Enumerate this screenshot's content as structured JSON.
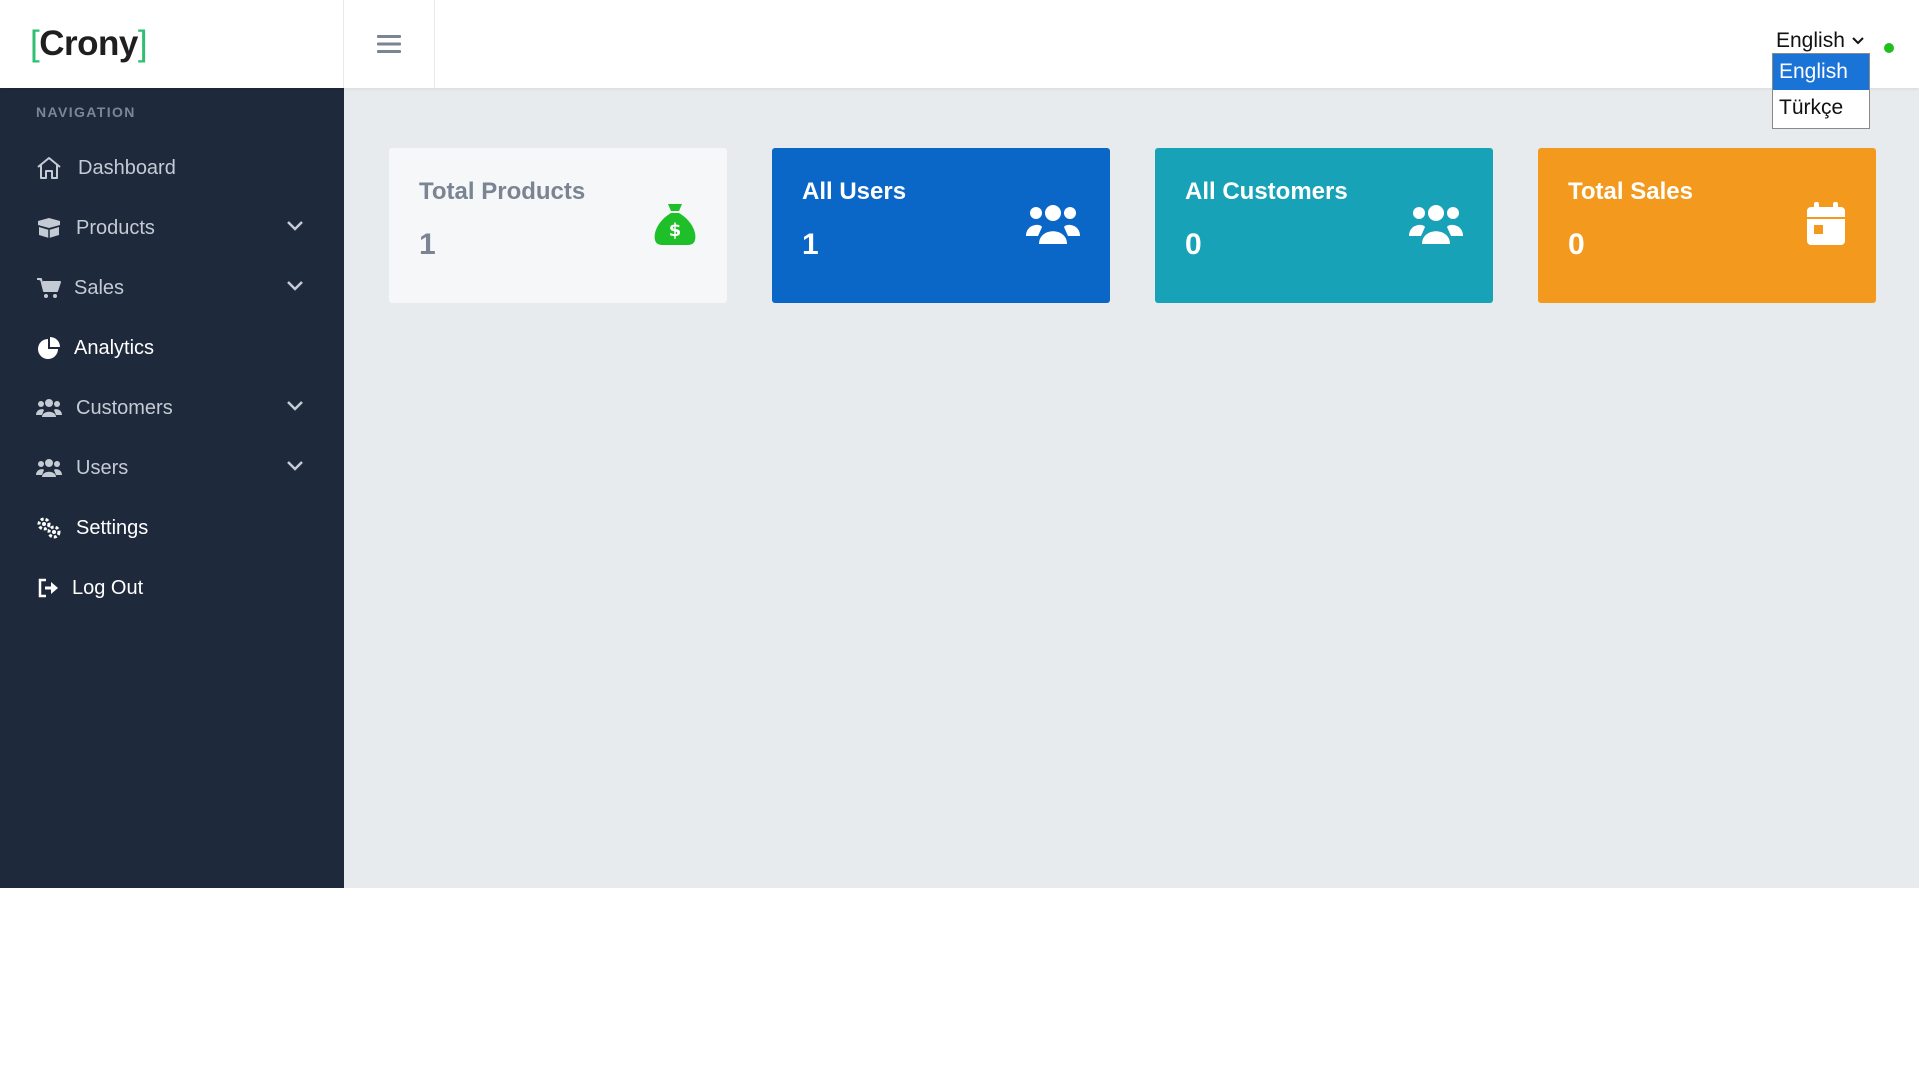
{
  "app": {
    "logo_open": "[",
    "logo_text": "Crony",
    "logo_close": "]"
  },
  "header": {
    "language": "English",
    "language_options": [
      "English",
      "Türkçe"
    ]
  },
  "sidebar": {
    "section_title": "NAVIGATION",
    "items": [
      {
        "label": "Dashboard",
        "icon": "home-icon"
      },
      {
        "label": "Products",
        "icon": "boxes-icon"
      },
      {
        "label": "Sales",
        "icon": "cart-icon"
      },
      {
        "label": "Analytics",
        "icon": "pie-chart-icon"
      },
      {
        "label": "Customers",
        "icon": "users-icon"
      },
      {
        "label": "Users",
        "icon": "users-icon"
      },
      {
        "label": "Settings",
        "icon": "gears-icon"
      },
      {
        "label": "Log Out",
        "icon": "logout-icon"
      }
    ]
  },
  "cards": [
    {
      "title": "Total Products",
      "value": "1",
      "icon": "money-bag-icon",
      "color": "#f5f7f9"
    },
    {
      "title": "All Users",
      "value": "1",
      "icon": "users-icon",
      "color": "#0b67c7"
    },
    {
      "title": "All Customers",
      "value": "0",
      "icon": "users-icon",
      "color": "#17a2b8"
    },
    {
      "title": "Total Sales",
      "value": "0",
      "icon": "calendar-icon",
      "color": "#f39a1e"
    }
  ],
  "colors": {
    "sidebar_bg": "#1e293b",
    "main_bg": "#e8ebee",
    "accent_green": "#2fbf71",
    "online": "#1fbf1f"
  }
}
